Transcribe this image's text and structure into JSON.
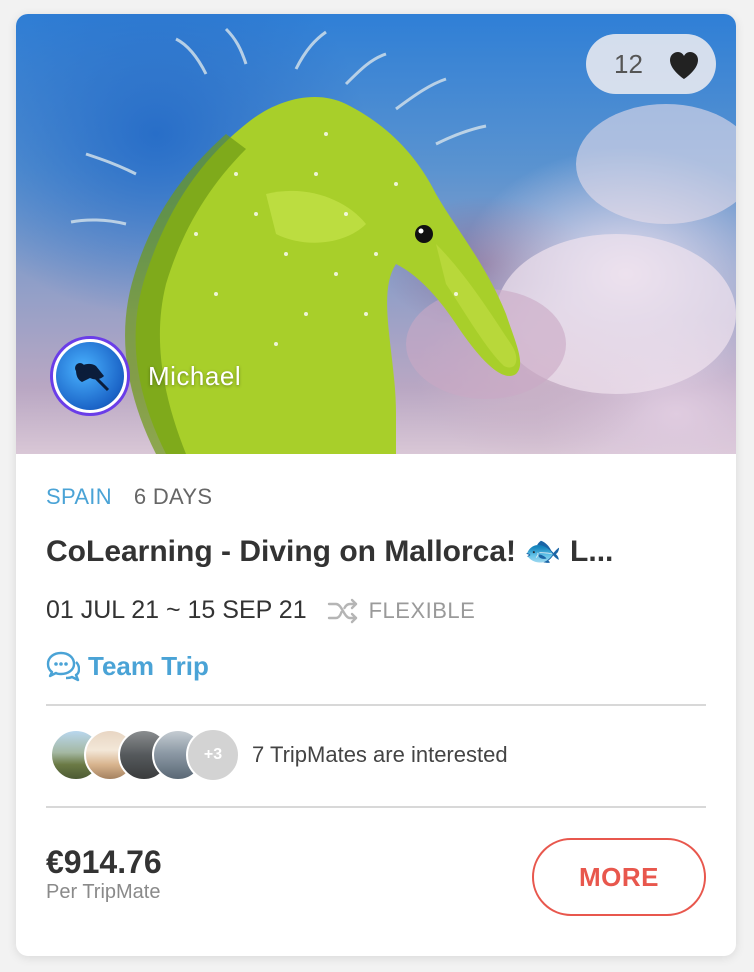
{
  "hero": {
    "like_count": "12",
    "host_name": "Michael"
  },
  "trip": {
    "country": "SPAIN",
    "duration": "6 DAYS",
    "title": "CoLearning - Diving on Mallorca! 🐟 L...",
    "date_range": "01 JUL 21 ~ 15 SEP 21",
    "date_flexibility": "FLEXIBLE",
    "trip_type": "Team Trip"
  },
  "tripmates": {
    "extra_count": "+3",
    "interest_text": "7 TripMates are interested"
  },
  "pricing": {
    "price": "€914.76",
    "unit": "Per TripMate"
  },
  "actions": {
    "more_label": "MORE"
  },
  "colors": {
    "accent_blue": "#4aa3d6",
    "cta_red": "#e8574d",
    "avatar_ring": "#6a3de8"
  }
}
